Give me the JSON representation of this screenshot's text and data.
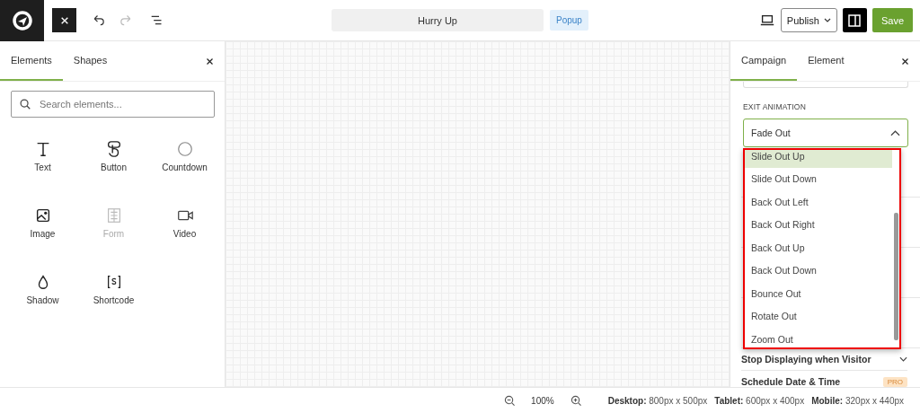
{
  "toolbar": {
    "title": "Hurry Up",
    "type_badge": "Popup",
    "publish": "Publish",
    "save": "Save"
  },
  "left_panel": {
    "tabs": [
      {
        "label": "Elements",
        "selected": true
      },
      {
        "label": "Shapes",
        "selected": false
      }
    ],
    "search": {
      "placeholder": "Search elements..."
    },
    "elements": [
      {
        "label": "Text",
        "kind": "text",
        "disabled": false
      },
      {
        "label": "Button",
        "kind": "button",
        "disabled": false
      },
      {
        "label": "Countdown",
        "kind": "countdown",
        "disabled": false
      },
      {
        "label": "Image",
        "kind": "image",
        "disabled": false
      },
      {
        "label": "Form",
        "kind": "form",
        "disabled": true
      },
      {
        "label": "Video",
        "kind": "video",
        "disabled": false
      },
      {
        "label": "Shadow",
        "kind": "shadow",
        "disabled": false
      },
      {
        "label": "Shortcode",
        "kind": "shortcode",
        "disabled": false
      }
    ]
  },
  "right_panel": {
    "tabs": [
      {
        "label": "Campaign",
        "selected": true
      },
      {
        "label": "Element",
        "selected": false
      }
    ],
    "exit_animation": {
      "label": "EXIT ANIMATION",
      "value": "Fade Out",
      "expanded": true,
      "options": [
        {
          "label": "Slide Out Up",
          "selected": true
        },
        {
          "label": "Slide Out Down",
          "selected": false
        },
        {
          "label": "Back Out Left",
          "selected": false
        },
        {
          "label": "Back Out Right",
          "selected": false
        },
        {
          "label": "Back Out Up",
          "selected": false
        },
        {
          "label": "Back Out Down",
          "selected": false
        },
        {
          "label": "Bounce Out",
          "selected": false
        },
        {
          "label": "Rotate Out",
          "selected": false
        },
        {
          "label": "Zoom Out",
          "selected": false
        }
      ]
    },
    "sections": [
      {
        "label": "Stop Displaying when Visitor"
      },
      {
        "label": "Schedule Date & Time",
        "badge": "PRO"
      }
    ]
  },
  "status_bar": {
    "zoom": "100%",
    "sizes": [
      {
        "label": "Desktop:",
        "value": "800px x 500px"
      },
      {
        "label": "Tablet:",
        "value": "600px x 400px"
      },
      {
        "label": "Mobile:",
        "value": "320px x 440px"
      }
    ]
  }
}
